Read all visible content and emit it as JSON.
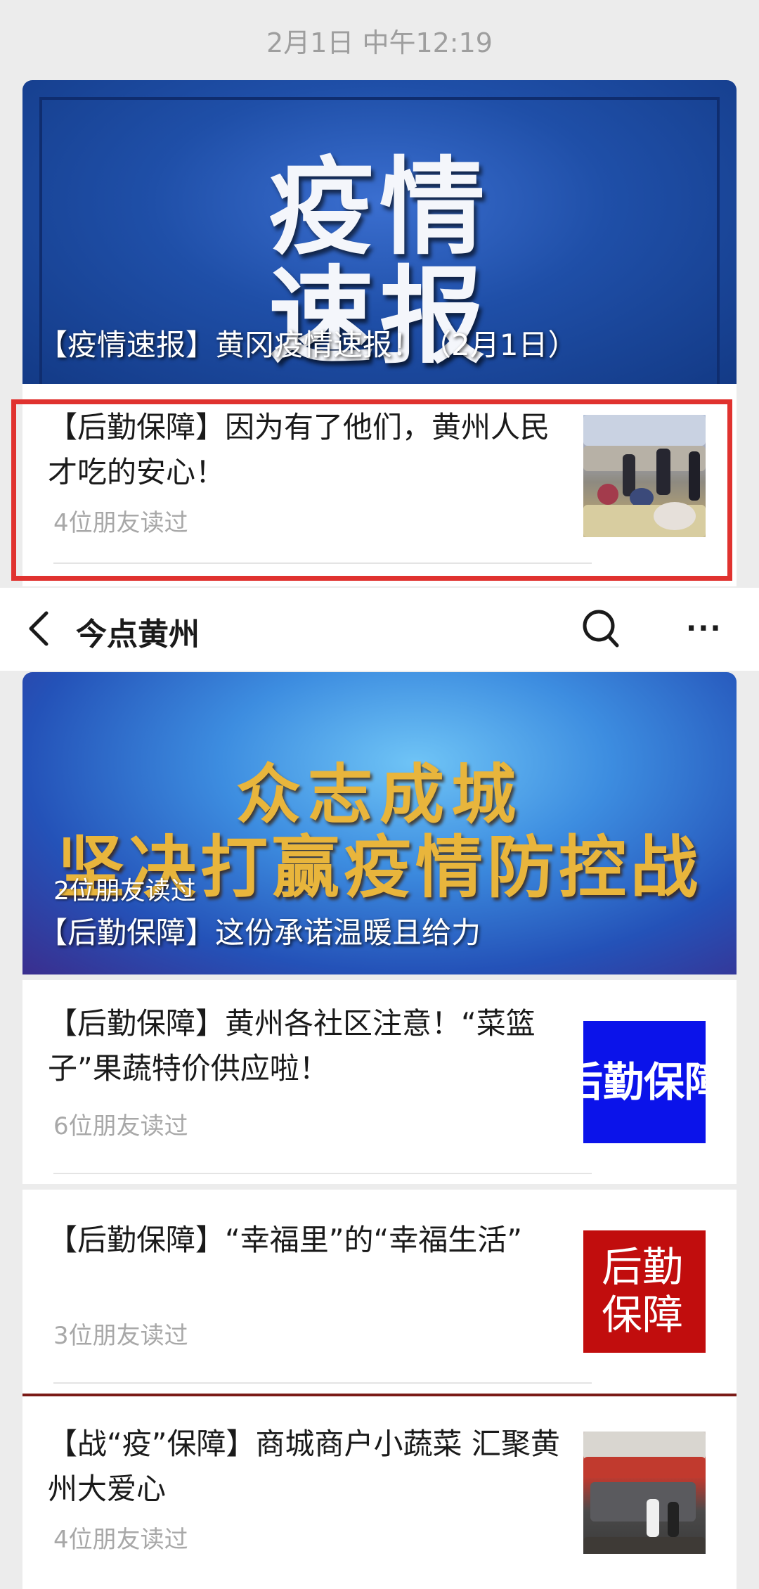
{
  "timestamp": "2月1日 中午12:19",
  "top_card": {
    "cover_art_line1": "疫情",
    "cover_art_line2": "速报",
    "cover_title": "【疫情速报】黄冈疫情速报！（2月1日）",
    "item": {
      "title": "【后勤保障】因为有了他们，黄州人民才吃的安心！",
      "reads": "4位朋友读过"
    }
  },
  "navbar": {
    "title": "今点黄州",
    "back_icon": "chevron-left-icon",
    "search_icon": "search-icon",
    "more_icon": "more-dots-icon",
    "more_glyph": "···"
  },
  "bottom_card": {
    "cover_art_line1": "众志成城",
    "cover_art_line2": "坚决打赢疫情防控战",
    "cover_reads": "2位朋友读过",
    "cover_title": "【后勤保障】这份承诺温暖且给力",
    "items": [
      {
        "title": "【后勤保障】黄州各社区注意！“菜篮子”果蔬特价供应啦！",
        "reads": "6位朋友读过",
        "thumb_text": "后勤保障"
      },
      {
        "title": "【后勤保障】“幸福里”的“幸福生活”",
        "reads": "3位朋友读过",
        "thumb_text": "后勤\n保障"
      },
      {
        "title": "【战“疫”保障】商城商户小蔬菜 汇聚黄州大爱心",
        "reads": "4位朋友读过"
      }
    ]
  },
  "colors": {
    "highlight_border": "#e0322f",
    "background": "#ececec",
    "thumb_blue": "#0b13ea",
    "thumb_red": "#c10d0d"
  }
}
